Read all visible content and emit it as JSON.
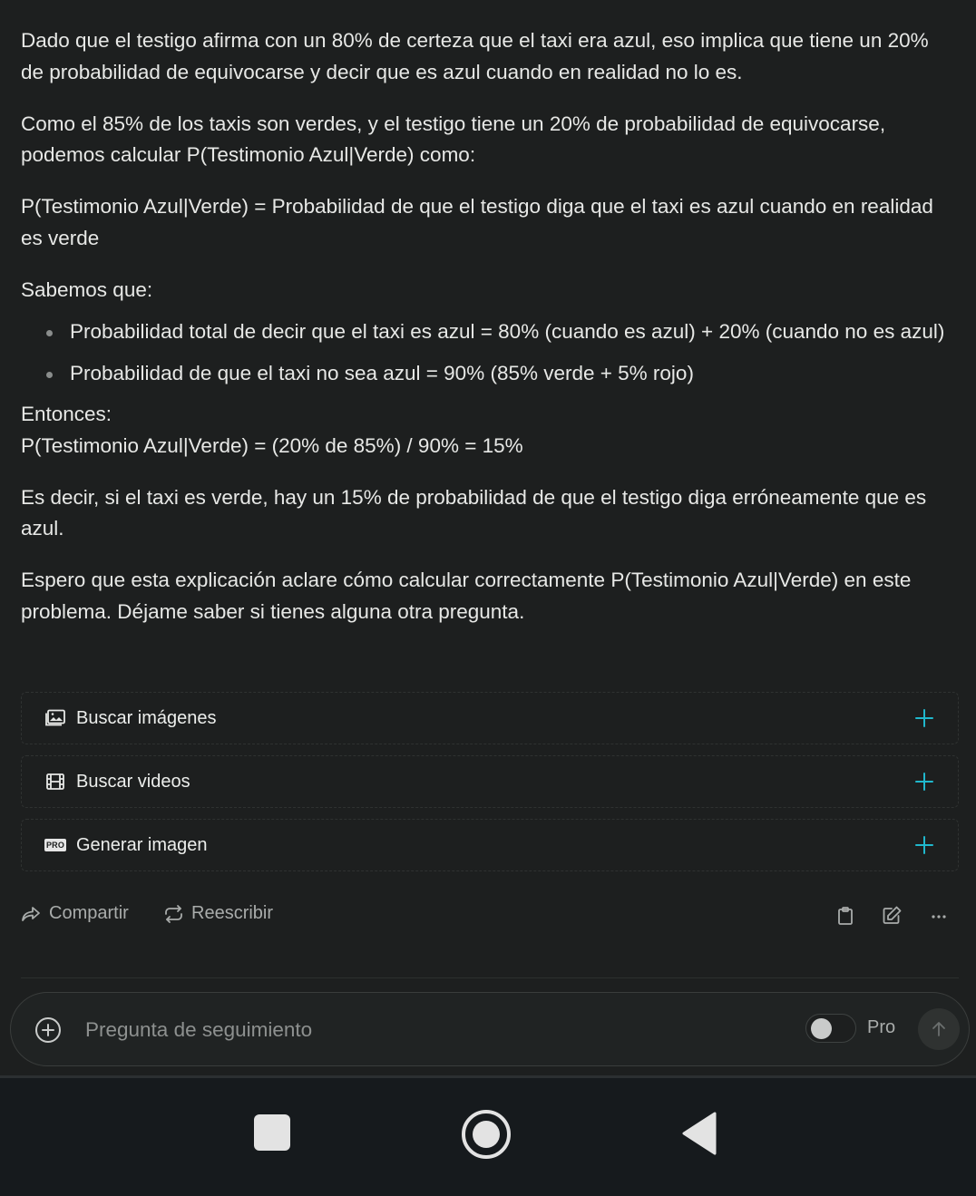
{
  "message": {
    "paragraphs": [
      "Dado que el testigo afirma con un 80% de certeza que el taxi era azul, eso implica que tiene un 20% de probabilidad de equivocarse y decir que es azul cuando en realidad no lo es.",
      "Como el 85% de los taxis son verdes, y el testigo tiene un 20% de probabilidad de equivocarse, podemos calcular P(Testimonio Azul|Verde) como:",
      "P(Testimonio Azul|Verde) = Probabilidad de que el testigo diga que el taxi es azul cuando en realidad es verde",
      "Sabemos que:"
    ],
    "bullets": [
      "Probabilidad total de decir que el taxi es azul = 80% (cuando es azul) + 20% (cuando no es azul)",
      "Probabilidad de que el taxi no sea azul = 90% (85% verde + 5% rojo)"
    ],
    "entonces_label": "Entonces:",
    "formula": "P(Testimonio Azul|Verde) = (20% de 85%) / 90% = 15%",
    "conclusion": "Es decir, si el taxi es verde, hay un 15% de probabilidad de que el testigo diga erróneamente que es azul.",
    "closing": "Espero que esta explicación aclare cómo calcular correctamente P(Testimonio Azul|Verde) en este problema. Déjame saber si tienes alguna otra pregunta."
  },
  "actions": {
    "search_images": "Buscar imágenes",
    "search_videos": "Buscar videos",
    "generate_image": "Generar imagen",
    "pro_badge": "PRO"
  },
  "toolbar": {
    "share": "Compartir",
    "rewrite": "Reescribir"
  },
  "composer": {
    "placeholder": "Pregunta de seguimiento",
    "pro_label": "Pro",
    "pro_enabled": false
  },
  "icons": {
    "image": "image-icon",
    "video": "film-icon",
    "plus": "plus-icon",
    "share": "share-arrow-icon",
    "rewrite": "repeat-icon",
    "copy": "clipboard-icon",
    "edit": "edit-icon",
    "more": "more-horizontal-icon",
    "add": "plus-circle-icon",
    "send": "arrow-up-icon"
  },
  "colors": {
    "background": "#1d1f1f",
    "text": "#e7e8e6",
    "accent": "#20b8cd",
    "muted": "#a9acab"
  }
}
